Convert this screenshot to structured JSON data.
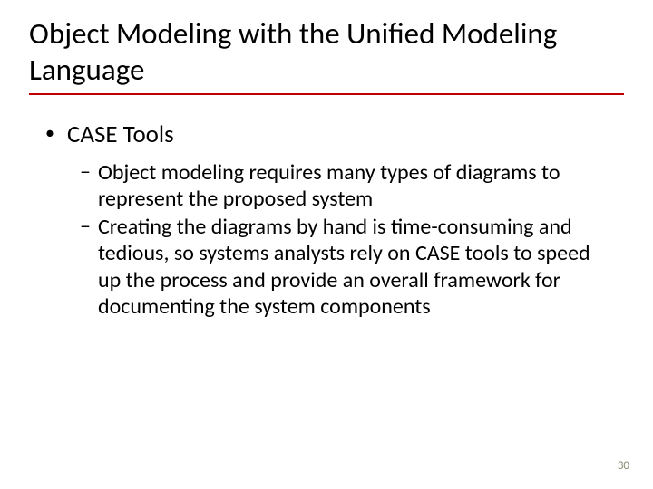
{
  "title": "Object Modeling with the Unified Modeling Language",
  "l1": {
    "item1": "CASE Tools"
  },
  "l2": {
    "item1": "Object modeling requires many types of diagrams to represent the proposed system",
    "item2": "Creating the diagrams by hand is time-consuming and tedious, so systems analysts rely on CASE tools to speed up the process and provide an overall framework for documenting the system components"
  },
  "page_number": "30"
}
